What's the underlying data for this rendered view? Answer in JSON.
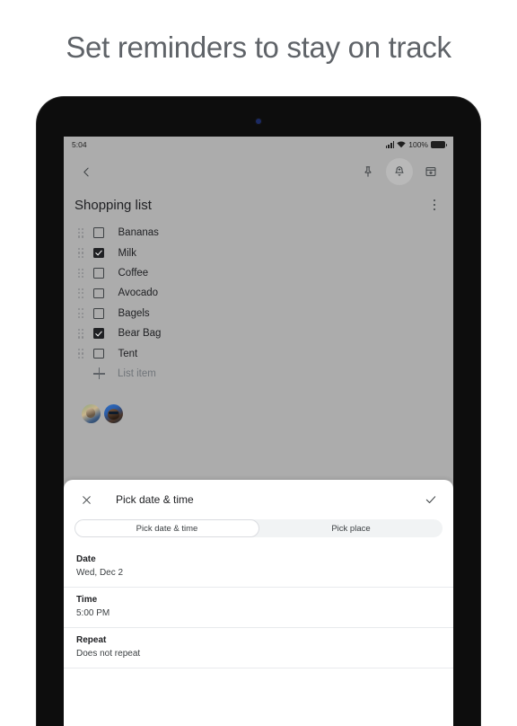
{
  "headline": "Set reminders to stay on track",
  "status_bar": {
    "time": "5:04",
    "battery_percent": "100%",
    "signal_icon": "cellular-signal-icon",
    "wifi_icon": "wifi-icon",
    "battery_icon": "battery-full-icon"
  },
  "toolbar": {
    "back_icon": "back-chevron-icon",
    "pin_icon": "pin-icon",
    "reminder_icon": "reminder-bell-icon",
    "archive_icon": "archive-icon"
  },
  "note": {
    "title": "Shopping list",
    "menu_icon": "overflow-menu-icon",
    "items": [
      {
        "label": "Bananas",
        "checked": false
      },
      {
        "label": "Milk",
        "checked": true
      },
      {
        "label": "Coffee",
        "checked": false
      },
      {
        "label": "Avocado",
        "checked": false
      },
      {
        "label": "Bagels",
        "checked": false
      },
      {
        "label": "Bear Bag",
        "checked": true
      },
      {
        "label": "Tent",
        "checked": false
      }
    ],
    "add_item_label": "List item",
    "add_item_icon": "plus-icon",
    "collaborators": [
      "collaborator-avatar-1",
      "collaborator-avatar-2"
    ]
  },
  "sheet": {
    "close_icon": "close-icon",
    "title": "Pick date & time",
    "confirm_icon": "check-icon",
    "tabs": [
      {
        "label": "Pick date & time",
        "selected": true
      },
      {
        "label": "Pick place",
        "selected": false
      }
    ],
    "rows": [
      {
        "label": "Date",
        "value": "Wed, Dec 2"
      },
      {
        "label": "Time",
        "value": "5:00 PM"
      },
      {
        "label": "Repeat",
        "value": "Does not repeat"
      }
    ]
  },
  "colors": {
    "page_background": "#ffffff",
    "headline_text": "#5f6368",
    "note_background": "#acacac",
    "sheet_background": "#ffffff",
    "primary_text": "#202124",
    "secondary_text": "#70757a",
    "divider": "#e8eaed",
    "segment_track": "#f1f3f4"
  }
}
